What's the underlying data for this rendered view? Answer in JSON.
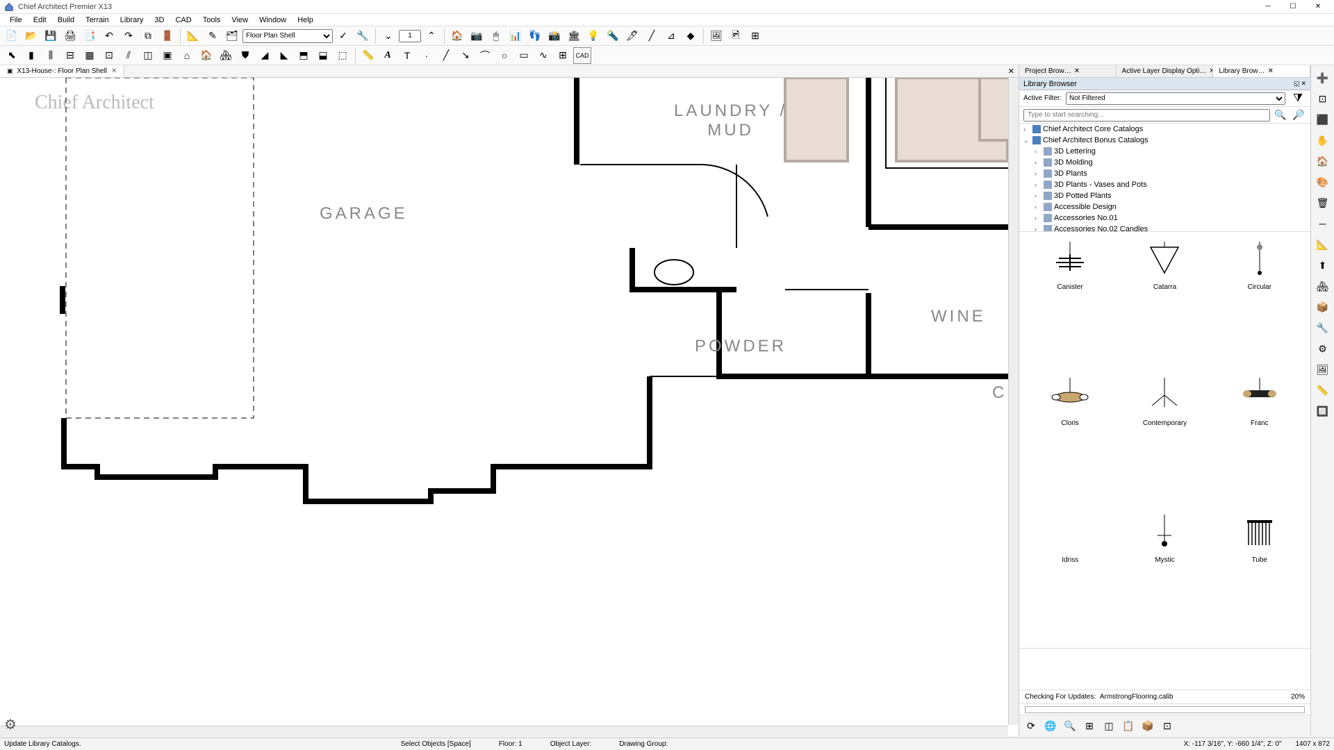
{
  "app": {
    "title": "Chief Architect Premier X13",
    "menus": [
      "File",
      "Edit",
      "Build",
      "Terrain",
      "Library",
      "3D",
      "CAD",
      "Tools",
      "View",
      "Window",
      "Help"
    ]
  },
  "toolbar": {
    "layerset_dropdown": "Floor Plan Shell",
    "number_input": "1"
  },
  "doc_tab": {
    "label": "X13-House-: Floor Plan Shell"
  },
  "rooms": {
    "garage": "GARAGE",
    "laundry": "LAUNDRY /\nMUD",
    "powder": "POWDER",
    "wine": "WINE",
    "clo": "CLO"
  },
  "watermark": "Chief Architect",
  "panel_tabs": {
    "tab1": "Project Brow…",
    "tab2": "Active Layer Display Opti…",
    "tab3": "Library Brow…"
  },
  "library": {
    "header": "Library Browser",
    "filter_label": "Active Filter:",
    "filter_value": "Not Filtered",
    "search_placeholder": "Type to start searching...",
    "tree": [
      {
        "level": 0,
        "exp": "›",
        "label": "Chief Architect Core Catalogs"
      },
      {
        "level": 0,
        "exp": "⌄",
        "label": "Chief Architect Bonus Catalogs"
      },
      {
        "level": 1,
        "exp": "›",
        "label": "3D Lettering"
      },
      {
        "level": 1,
        "exp": "›",
        "label": "3D Molding"
      },
      {
        "level": 1,
        "exp": "›",
        "label": "3D Plants"
      },
      {
        "level": 1,
        "exp": "›",
        "label": "3D Plants - Vases and Pots"
      },
      {
        "level": 1,
        "exp": "›",
        "label": "3D Potted Plants"
      },
      {
        "level": 1,
        "exp": "›",
        "label": "Accessible Design"
      },
      {
        "level": 1,
        "exp": "›",
        "label": "Accessories No.01"
      },
      {
        "level": 1,
        "exp": "›",
        "label": "Accessories No.02 Candles"
      }
    ],
    "thumbs": [
      "Canister",
      "Catarra",
      "Circular",
      "Cloris",
      "Contemporary",
      "Franc",
      "Idriss",
      "Mystic",
      "Tube"
    ],
    "update_label": "Checking For Updates:",
    "update_file": "ArmstrongFlooring.calib",
    "update_pct": "20%"
  },
  "status": {
    "left": "Update Library Catalogs.",
    "hint": "Select Objects  [Space]",
    "floor": "Floor: 1",
    "layer": "Object Layer:",
    "group": "Drawing Group:",
    "coords": "X: -117 3/16\", Y: -660 1/4\", Z: 0\"",
    "dim": "1407 x 872"
  }
}
